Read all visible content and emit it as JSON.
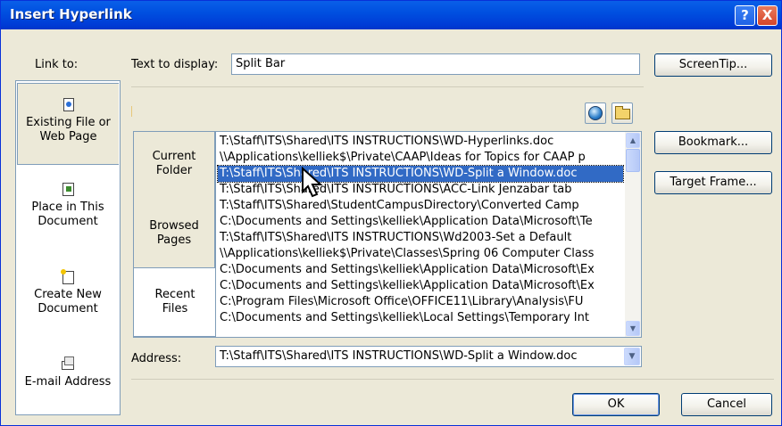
{
  "window": {
    "title": "Insert Hyperlink"
  },
  "titlebar": {
    "help_label": "?",
    "close_label": "X"
  },
  "link_to": {
    "label": "Link to:",
    "items": [
      {
        "line1": "Existing File or",
        "line2": "Web Page",
        "selected": true
      },
      {
        "line1": "Place in This",
        "line2": "Document"
      },
      {
        "line1": "Create New",
        "line2": "Document"
      },
      {
        "line1": "E-mail Address",
        "line2": ""
      }
    ]
  },
  "text_to_display": {
    "label": "Text to display:",
    "value": "Split Bar"
  },
  "buttons": {
    "screentip": "ScreenTip...",
    "bookmark": "Bookmark...",
    "target_frame": "Target Frame...",
    "ok": "OK",
    "cancel": "Cancel"
  },
  "sources": [
    {
      "line1": "Current",
      "line2": "Folder"
    },
    {
      "line1": "Browsed",
      "line2": "Pages"
    },
    {
      "line1": "Recent",
      "line2": "Files",
      "selected": true
    }
  ],
  "recent_files": [
    "T:\\Staff\\ITS\\Shared\\ITS INSTRUCTIONS\\WD-Hyperlinks.doc",
    "\\\\Applications\\kelliek$\\Private\\CAAP\\Ideas for Topics for CAAP p",
    "T:\\Staff\\ITS\\Shared\\ITS INSTRUCTIONS\\WD-Split a Window.doc",
    "T:\\Staff\\ITS\\Shared\\ITS INSTRUCTIONS\\ACC-Link Jenzabar tab",
    "T:\\Staff\\ITS\\Shared\\StudentCampusDirectory\\Converted Camp",
    "C:\\Documents and Settings\\kelliek\\Application Data\\Microsoft\\Te",
    "T:\\Staff\\ITS\\Shared\\ITS INSTRUCTIONS\\Wd2003-Set a Default",
    "\\\\Applications\\kelliek$\\Private\\Classes\\Spring 06 Computer Class",
    "C:\\Documents and Settings\\kelliek\\Application Data\\Microsoft\\Ex",
    "C:\\Documents and Settings\\kelliek\\Application Data\\Microsoft\\Ex",
    "C:\\Program Files\\Microsoft Office\\OFFICE11\\Library\\Analysis\\FU",
    "C:\\Documents and Settings\\kelliek\\Local Settings\\Temporary Int"
  ],
  "address": {
    "label": "Address:",
    "value": "T:\\Staff\\ITS\\Shared\\ITS INSTRUCTIONS\\WD-Split a Window.doc"
  },
  "icons": {
    "browse_web": "globe-icon",
    "browse_file": "open-folder-icon"
  },
  "colors": {
    "titlebar": "#0050E0",
    "selection": "#316AC5",
    "dialog_bg": "#ECE9D8"
  }
}
